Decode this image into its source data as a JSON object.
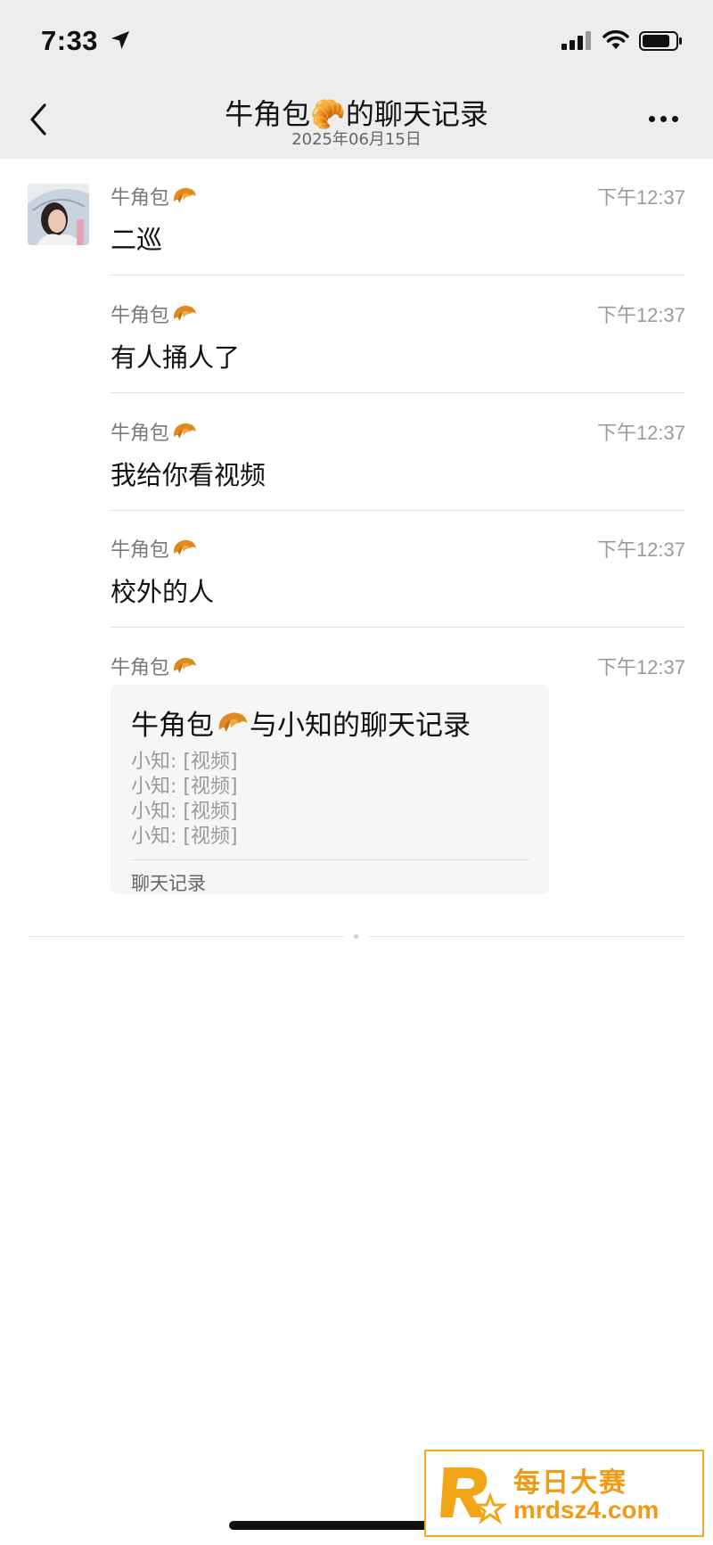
{
  "status_bar": {
    "time": "7:33"
  },
  "header": {
    "title": "牛角包🥐的聊天记录",
    "date": "2025年06月15日"
  },
  "messages": [
    {
      "sender": "牛角包",
      "time": "下午12:37",
      "text": "二巡"
    },
    {
      "sender": "牛角包",
      "time": "下午12:37",
      "text": "有人捅人了"
    },
    {
      "sender": "牛角包",
      "time": "下午12:37",
      "text": "我给你看视频"
    },
    {
      "sender": "牛角包",
      "time": "下午12:37",
      "text": "校外的人"
    },
    {
      "sender": "牛角包",
      "time": "下午12:37",
      "text": ""
    }
  ],
  "forwarded_card": {
    "title_part1": "牛角包",
    "title_part2": "与小知的聊天记录",
    "lines": [
      "小知: [视频]",
      "小知: [视频]",
      "小知: [视频]",
      "小知: [视频]"
    ],
    "footer": "聊天记录"
  },
  "watermark": {
    "brand_cn": "每日大赛",
    "url": "mrdsz4.com"
  },
  "colors": {
    "header_bg": "#ededed",
    "card_bg": "#f6f6f6",
    "watermark": "#f29a13"
  }
}
